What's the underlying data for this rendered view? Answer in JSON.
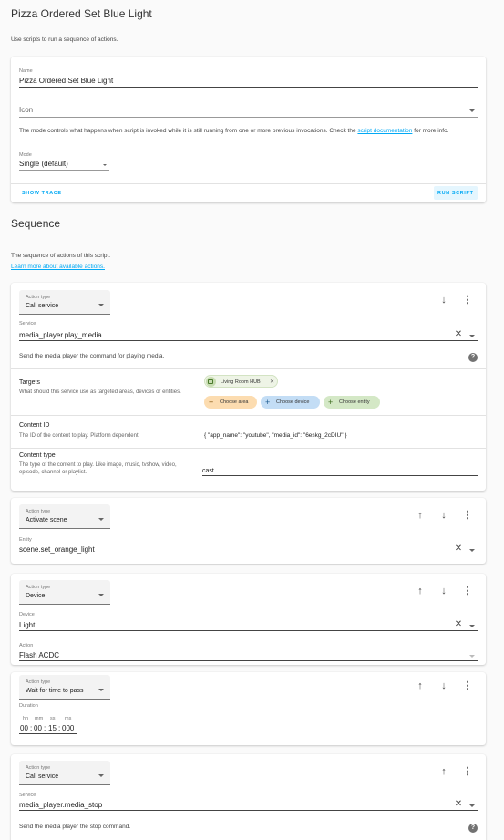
{
  "header": {
    "title": "Pizza Ordered Set Blue Light",
    "subtitle": "Use scripts to run a sequence of actions."
  },
  "script_card": {
    "name_label": "Name",
    "name_value": "Pizza Ordered Set Blue Light",
    "icon_label": "Icon",
    "mode_text_before": "The mode controls what happens when script is invoked while it is still running from one or more previous invocations. Check the",
    "mode_link": "script documentation",
    "mode_text_after": "for more info.",
    "mode_label": "Mode",
    "mode_value": "Single (default)",
    "show_trace": "SHOW TRACE",
    "run_script": "RUN SCRIPT"
  },
  "sequence": {
    "title": "Sequence",
    "desc": "The sequence of actions of this script.",
    "learn_more": "Learn more about available actions."
  },
  "icons": {
    "arrow_up": "arrow-up-icon",
    "arrow_down": "arrow-down-icon",
    "menu": "dots-vertical-icon",
    "clear": "close-icon",
    "help": "help-circle-icon",
    "cast": "cast-icon",
    "plus": "plus-icon"
  },
  "actions": [
    {
      "type_label": "Action type",
      "type_value": "Call service",
      "service_label": "Service",
      "service_value": "media_player.play_media",
      "service_desc": "Send the media player the command for playing media.",
      "targets_title": "Targets",
      "targets_desc": "What should this service use as targeted areas, devices or entities.",
      "target_chip": "Living Room HUB",
      "choose_area": "Choose area",
      "choose_device": "Choose device",
      "choose_entity": "Choose entity",
      "content_id_title": "Content ID",
      "content_id_desc": "The ID of the content to play. Platform dependent.",
      "content_id_value": "{ \"app_name\": \"youtube\", \"media_id\": \"6eskg_2cDIU\" }",
      "content_type_title": "Content type",
      "content_type_desc": "The type of the content to play. Like image, music, tvshow, video, episode, channel or playlist.",
      "content_type_value": "cast"
    },
    {
      "type_label": "Action type",
      "type_value": "Activate scene",
      "entity_label": "Entity",
      "entity_value": "scene.set_orange_light"
    },
    {
      "type_label": "Action type",
      "type_value": "Device",
      "device_label": "Device",
      "device_value": "Light",
      "action_label": "Action",
      "action_value": "Flash ACDC"
    },
    {
      "type_label": "Action type",
      "type_value": "Wait for time to pass",
      "duration_label": "Duration",
      "unit_hh": "hh",
      "unit_mm": "mm",
      "unit_ss": "ss",
      "unit_ms": "ms",
      "hh": "00",
      "mm": "00",
      "ss": "15",
      "ms": "000",
      "sep": ":"
    },
    {
      "type_label": "Action type",
      "type_value": "Call service",
      "service_label": "Service",
      "service_value": "media_player.media_stop",
      "service_desc": "Send the media player the stop command."
    }
  ]
}
